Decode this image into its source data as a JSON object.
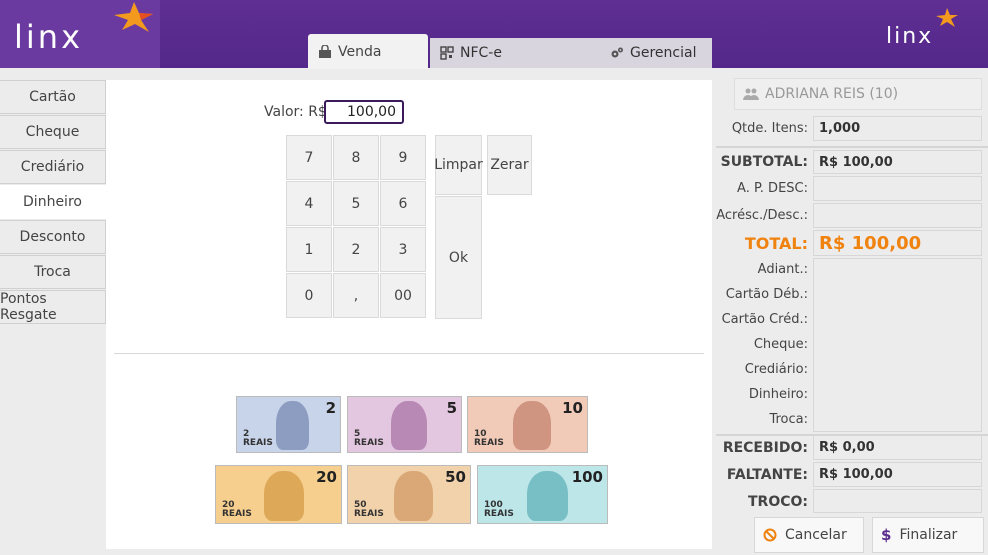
{
  "header": {
    "logo_left": "linx",
    "logo_right": "linx"
  },
  "tabs": [
    {
      "label": "Venda",
      "icon": "shopping-bag-icon"
    },
    {
      "label": "NFC-e",
      "icon": "qr-code-icon"
    },
    {
      "label": "Gerencial",
      "icon": "gears-icon"
    }
  ],
  "menu": {
    "items": [
      "Cartão",
      "Cheque",
      "Crediário",
      "Dinheiro",
      "Desconto",
      "Troca",
      "Pontos Resgate"
    ],
    "active": "Dinheiro"
  },
  "payment": {
    "valor_label": "Valor: R$",
    "valor_value": "100,00",
    "keys": [
      "7",
      "8",
      "9",
      "4",
      "5",
      "6",
      "1",
      "2",
      "3",
      "0",
      ",",
      "00"
    ],
    "limpar_label": "Limpar",
    "zerar_label": "Zerar",
    "ok_label": "Ok"
  },
  "banknotes": [
    {
      "value": "2",
      "label": "2\nREAIS",
      "color": "#8ea6cf"
    },
    {
      "value": "5",
      "label": "5\nREAIS",
      "color": "#c79cc5"
    },
    {
      "value": "10",
      "label": "10\nREAIS",
      "color": "#e3a98f"
    },
    {
      "value": "20",
      "label": "20\nREAIS",
      "color": "#f0b651"
    },
    {
      "value": "50",
      "label": "50\nREAIS",
      "color": "#e9b07a"
    },
    {
      "value": "100",
      "label": "100\nREAIS",
      "color": "#6fc7cf"
    }
  ],
  "summary": {
    "customer": "ADRIANA REIS (10)",
    "qtde_label": "Qtde. Itens:",
    "qtde_value": "1,000",
    "subtotal_label": "SUBTOTAL:",
    "subtotal_value": "R$ 100,00",
    "apdesc_label": "A. P. DESC:",
    "apdesc_value": "",
    "acresc_label": "Acrésc./Desc.:",
    "acresc_value": "",
    "total_label": "TOTAL:",
    "total_value": "R$ 100,00",
    "adiant_label": "Adiant.:",
    "cartao_deb_label": "Cartão Déb.:",
    "cartao_cred_label": "Cartão Créd.:",
    "cheque_label": "Cheque:",
    "crediario_label": "Crediário:",
    "dinheiro_label": "Dinheiro:",
    "troca_label": "Troca:",
    "recebido_label": "RECEBIDO:",
    "recebido_value": "R$ 0,00",
    "faltante_label": "FALTANTE:",
    "faltante_value": "R$ 100,00",
    "troco_label": "TROCO:",
    "troco_value": ""
  },
  "actions": {
    "cancel_label": "Cancelar",
    "finish_label": "Finalizar"
  },
  "colors": {
    "header": "#5a2d8c",
    "accent_orange": "#f0820f",
    "valor_border": "#3a1a5a"
  }
}
